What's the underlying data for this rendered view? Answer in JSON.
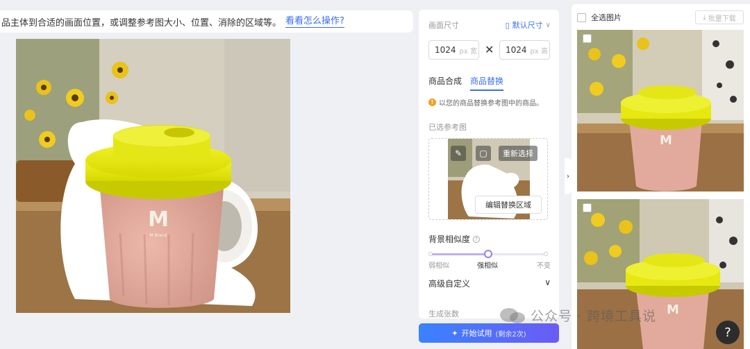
{
  "tip": {
    "text": "品主体到合适的画面位置，或调整参考图大小、位置、消除的区域等。",
    "link": "看看怎么操作?"
  },
  "canvas": {
    "logo_letter": "M",
    "logo_subtext": "M Brand",
    "colors": {
      "lid": "#e6e80a",
      "cup": "#e0a89a",
      "bg_top": "#d9d6c9",
      "table": "#8a643d"
    }
  },
  "panel": {
    "size_label": "画面尺寸",
    "default_size": "默认尺寸",
    "width": {
      "value": "1024",
      "unit": "px 宽"
    },
    "times": "✕",
    "height": {
      "value": "1024",
      "unit": "px 高"
    },
    "tabs": [
      {
        "label": "商品合成",
        "active": false
      },
      {
        "label": "商品替换",
        "active": true
      }
    ],
    "notice": "以您的商品替换参考图中的商品。",
    "ref_label": "已选参考图",
    "reselect": "重新选择",
    "edit_area": "编辑替换区域",
    "similarity_label": "背景相似度",
    "similarity_options": [
      "弱相似",
      "强相似",
      "不变"
    ],
    "similarity_selected": 1,
    "advanced": "高级自定义",
    "gen_count": "生成张数",
    "start_button": "开始试用",
    "remaining": "(剩余2次)"
  },
  "results": {
    "select_all": "全选图片",
    "batch_download": "批量下载",
    "collapse_icon": "chevron-right-icon"
  },
  "watermark": "公众号 · 跨境工具说",
  "help": "?"
}
